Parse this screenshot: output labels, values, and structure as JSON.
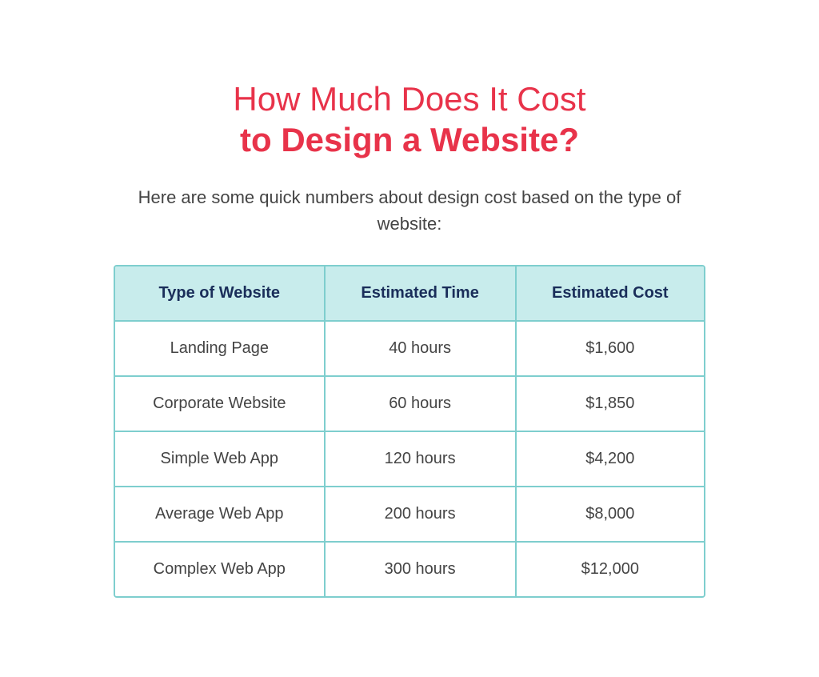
{
  "header": {
    "title_line1": "How Much Does It Cost",
    "title_line2": "to Design a Website?",
    "subtitle": "Here are some quick numbers about design cost based on the type of website:"
  },
  "table": {
    "columns": [
      {
        "key": "col_type",
        "label": "Type of Website"
      },
      {
        "key": "col_time",
        "label": "Estimated Time"
      },
      {
        "key": "col_cost",
        "label": "Estimated Cost"
      }
    ],
    "rows": [
      {
        "type": "Landing Page",
        "time": "40 hours",
        "cost": "$1,600"
      },
      {
        "type": "Corporate Website",
        "time": "60 hours",
        "cost": "$1,850"
      },
      {
        "type": "Simple Web App",
        "time": "120 hours",
        "cost": "$4,200"
      },
      {
        "type": "Average Web App",
        "time": "200 hours",
        "cost": "$8,000"
      },
      {
        "type": "Complex Web App",
        "time": "300 hours",
        "cost": "$12,000"
      }
    ]
  }
}
